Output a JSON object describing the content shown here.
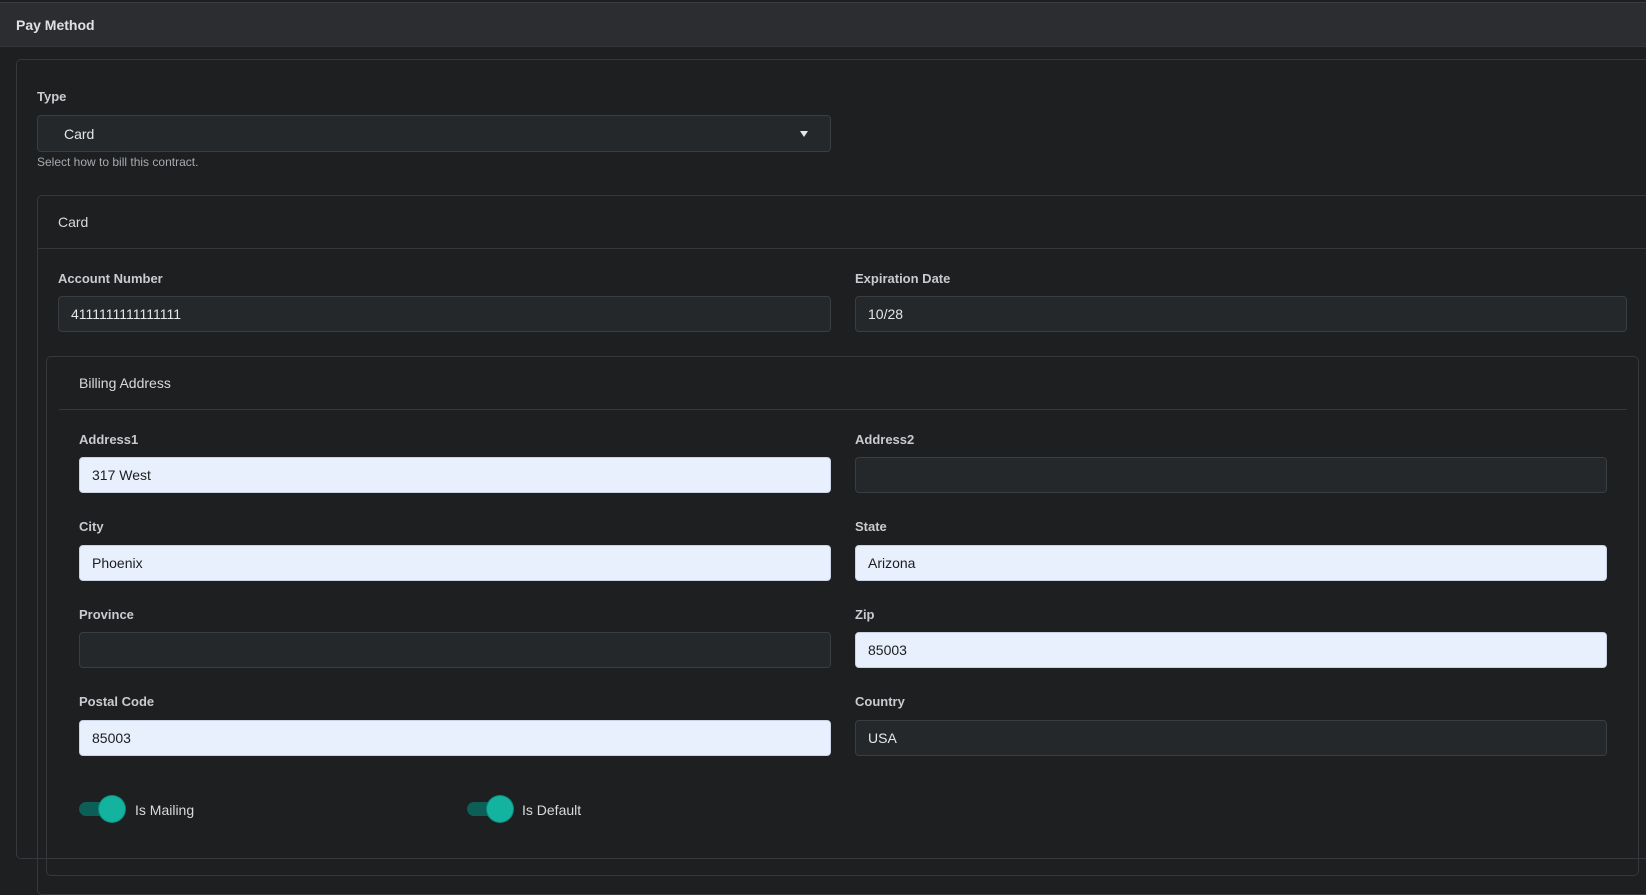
{
  "header": {
    "title": "Pay Method"
  },
  "type_field": {
    "label": "Type",
    "value": "Card",
    "help": "Select how to bill this contract."
  },
  "card_section": {
    "title": "Card",
    "account_number": {
      "label": "Account Number",
      "value": "4111111111111111"
    },
    "expiration_date": {
      "label": "Expiration Date",
      "value": "10/28"
    }
  },
  "billing": {
    "title": "Billing Address",
    "address1": {
      "label": "Address1",
      "value": "317 West"
    },
    "address2": {
      "label": "Address2",
      "value": ""
    },
    "city": {
      "label": "City",
      "value": "Phoenix"
    },
    "state": {
      "label": "State",
      "value": "Arizona"
    },
    "province": {
      "label": "Province",
      "value": ""
    },
    "zip": {
      "label": "Zip",
      "value": "85003"
    },
    "postal_code": {
      "label": "Postal Code",
      "value": "85003"
    },
    "country": {
      "label": "Country",
      "value": "USA"
    }
  },
  "toggles": {
    "is_mailing": {
      "label": "Is Mailing",
      "on": true
    },
    "is_default": {
      "label": "Is Default",
      "on": true
    }
  },
  "colors": {
    "background": "#1d1f21",
    "header": "#2b2d30",
    "accent": "#14b3a0",
    "autofill": "#e8f0fe"
  }
}
